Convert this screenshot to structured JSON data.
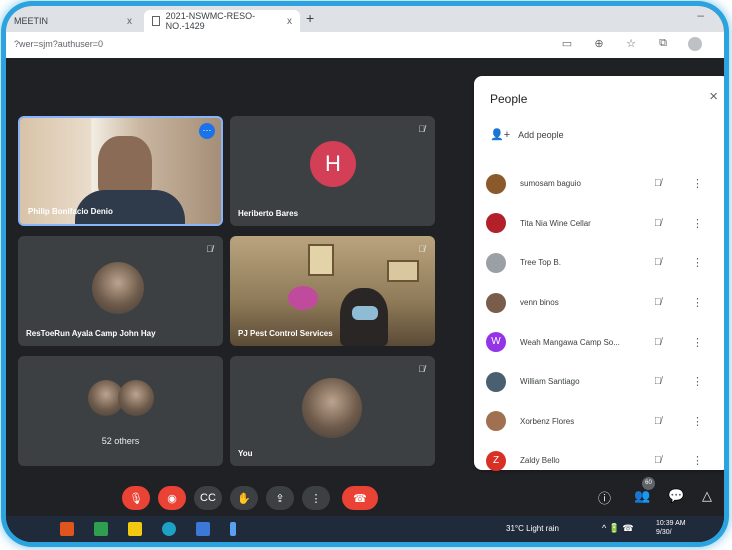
{
  "browser": {
    "tab1_label": "MEETIN",
    "tab1_close": "x",
    "tab2_label": "2021-NSWMC-RESO-NO.-1429",
    "tab2_close": "x",
    "new_tab": "+",
    "window_controls": "–",
    "url": "?wer=sjm?authuser=0"
  },
  "tiles": {
    "t1_name": "Philip Bonifacio Denio",
    "t2_initial": "H",
    "t2_name": "Heriberto Bares",
    "t3_name": "ResToeRun Ayala Camp John Hay",
    "t4_name": "PJ Pest Control Services",
    "t5_count": "52 others",
    "t6_name": "You"
  },
  "panel": {
    "title": "People",
    "close": "×",
    "add_people": "Add people",
    "people": [
      {
        "name": "sumosam baguio",
        "color": "#8a5a2b",
        "initial": ""
      },
      {
        "name": "Tita Nia Wine Cellar",
        "color": "#b3202a",
        "initial": ""
      },
      {
        "name": "Tree Top B.",
        "color": "#9aa0a6",
        "initial": ""
      },
      {
        "name": "venn binos",
        "color": "#7a5c4a",
        "initial": ""
      },
      {
        "name": "Weah Mangawa Camp So...",
        "color": "#9334e6",
        "initial": "W"
      },
      {
        "name": "William Santiago",
        "color": "#4a6070",
        "initial": ""
      },
      {
        "name": "Xorbenz Flores",
        "color": "#a07050",
        "initial": ""
      },
      {
        "name": "Zaldy Bello",
        "color": "#d93025",
        "initial": "Z"
      }
    ]
  },
  "controls": {
    "participants_badge": "60"
  },
  "taskbar": {
    "weather": "31°C Light rain",
    "time": "10:39 AM",
    "date": "9/30/"
  }
}
